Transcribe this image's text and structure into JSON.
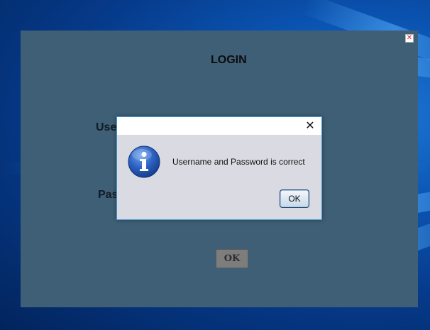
{
  "login_window": {
    "title": "LOGIN",
    "username_label": "Use",
    "password_label": "Pas",
    "ok_label": "OK",
    "close_glyph": "✕"
  },
  "dialog": {
    "message": "Username and Password is correct",
    "ok_label": "OK",
    "close_glyph": "✕",
    "icon": "info-icon"
  },
  "colors": {
    "window_background": "#3e5f76",
    "dialog_background": "#d9dae2",
    "dialog_border": "#4a9ad8",
    "info_icon_blue": "#1f56b8"
  }
}
